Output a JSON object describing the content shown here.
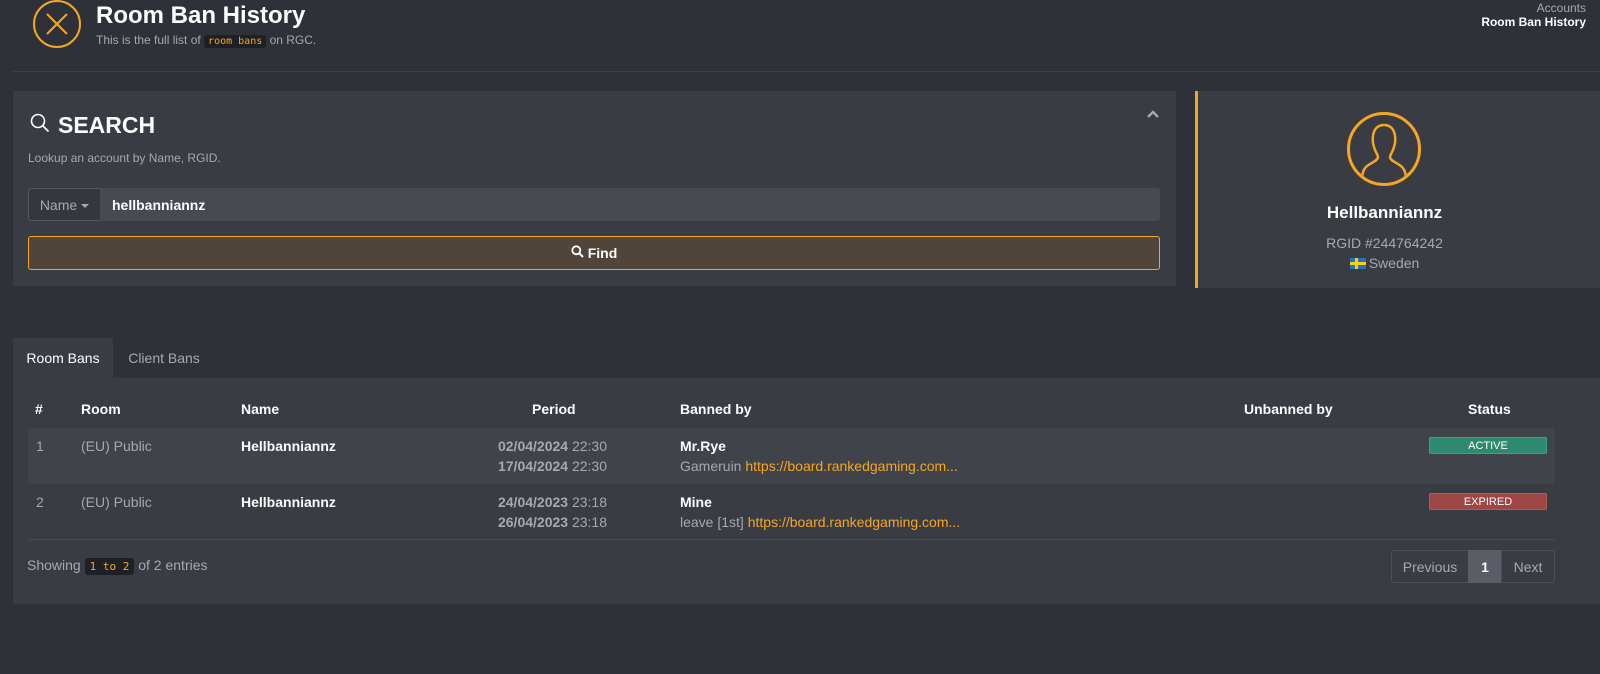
{
  "header": {
    "title": "Room Ban History",
    "subtitle_pre": "This is the full list of",
    "subtitle_code": "room bans",
    "subtitle_post": "on RGC.",
    "icon": "close-circle-icon"
  },
  "breadcrumb": {
    "parent": "Accounts",
    "current": "Room Ban History"
  },
  "search": {
    "title": "SEARCH",
    "help": "Lookup an account by Name, RGID.",
    "field_type": "Name",
    "value": "hellbanniannz",
    "find_label": "Find"
  },
  "profile": {
    "name": "Hellbanniannz",
    "rgid": "RGID #244764242",
    "country": "Sweden"
  },
  "tabs": [
    {
      "label": "Room Bans",
      "active": true
    },
    {
      "label": "Client Bans",
      "active": false
    }
  ],
  "table": {
    "columns": [
      "#",
      "Room",
      "Name",
      "Period",
      "Banned by",
      "Unbanned by",
      "Status"
    ],
    "rows": [
      {
        "num": "1",
        "room": "(EU) Public",
        "name": "Hellbanniannz",
        "start_date": "02/04/2024",
        "start_time": "22:30",
        "end_date": "17/04/2024",
        "end_time": "22:30",
        "banned_by": "Mr.Rye",
        "reason": "Gameruin",
        "link": "https://board.rankedgaming.com...",
        "unbanned_by": "",
        "status": "ACTIVE"
      },
      {
        "num": "2",
        "room": "(EU) Public",
        "name": "Hellbanniannz",
        "start_date": "24/04/2023",
        "start_time": "23:18",
        "end_date": "26/04/2023",
        "end_time": "23:18",
        "banned_by": "Mine",
        "reason": "leave [1st]",
        "link": "https://board.rankedgaming.com...",
        "unbanned_by": "",
        "status": "EXPIRED"
      }
    ]
  },
  "footer": {
    "showing_pre": "Showing",
    "showing_range": "1 to 2",
    "showing_post": "of 2 entries"
  },
  "pagination": {
    "previous": "Previous",
    "current": "1",
    "next": "Next"
  },
  "colors": {
    "accent": "#f5a623",
    "active": "#2e8a6e",
    "expired": "#9e4545"
  }
}
